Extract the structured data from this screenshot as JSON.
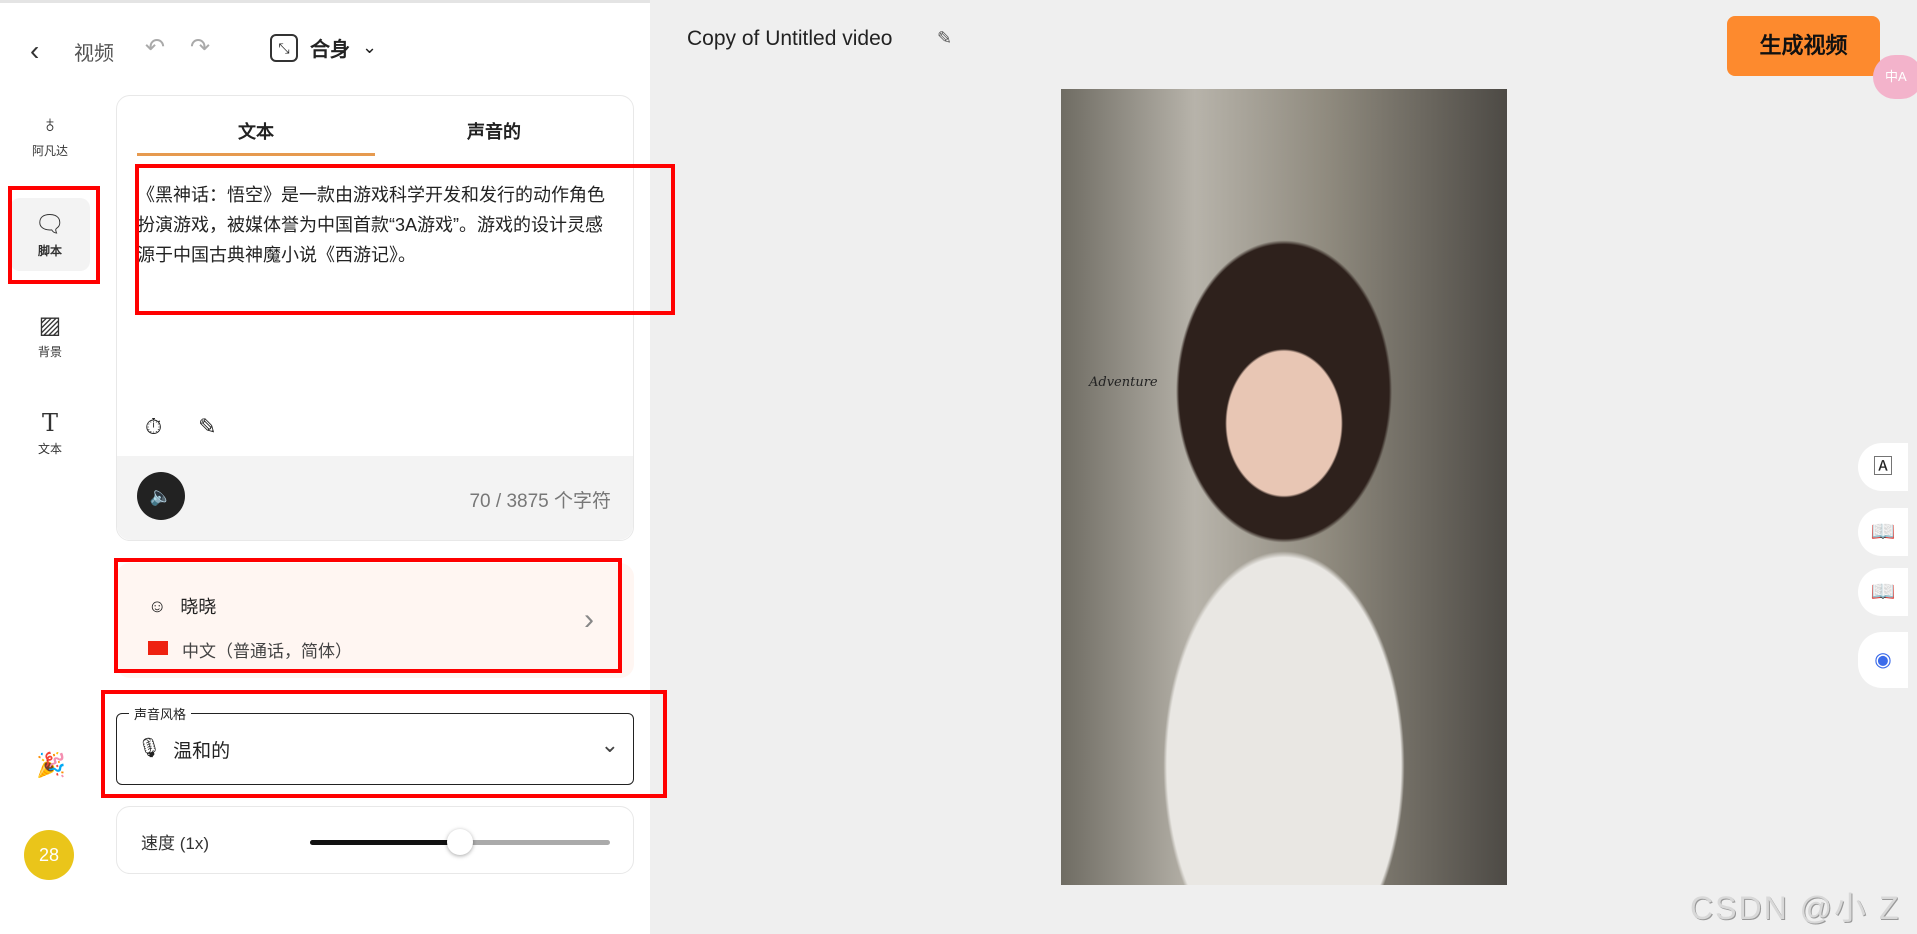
{
  "header": {
    "back_label": "视频",
    "fit_label": "合身"
  },
  "nav": [
    {
      "label": "阿凡达",
      "icon": "person-icon"
    },
    {
      "label": "脚本",
      "icon": "chat-icon"
    },
    {
      "label": "背景",
      "icon": "stripes-icon"
    },
    {
      "label": "文本",
      "icon": "text-icon"
    }
  ],
  "tabs": [
    "文本",
    "声音的"
  ],
  "script": {
    "text": "《黑神话：悟空》是一款由游戏科学开发和发行的动作角色扮演游戏，被媒体誉为中国首款“3A游戏”。游戏的设计灵感源于中国古典神魔小说《西游记》。",
    "char_count": "70 / 3875 个字符"
  },
  "voice": {
    "name": "晓晓",
    "language": "中文（普通话，简体）"
  },
  "style": {
    "label": "声音风格",
    "value": "温和的"
  },
  "speed": {
    "label": "速度 (1x)",
    "value_fraction": 0.5
  },
  "avatar": {
    "count": "28"
  },
  "editor": {
    "title": "Copy of Untitled video",
    "generate_label": "生成视频",
    "translate_badge": "中A"
  },
  "photo": {
    "logo_text": "Adventure"
  },
  "watermark": "CSDN @小 Z",
  "colors": {
    "accent": "#fd8a2e",
    "highlight": "#ff0000",
    "avatar": "#eac51a"
  }
}
